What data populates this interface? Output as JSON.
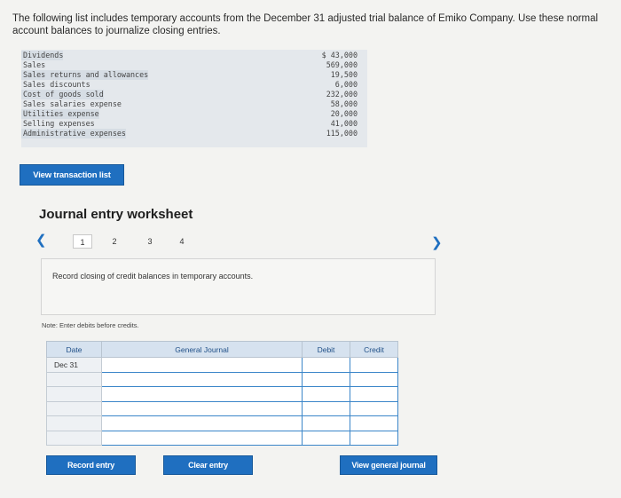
{
  "instructions": "The following list includes temporary accounts from the December 31 adjusted trial balance of Emiko Company. Use these normal account balances to journalize closing entries.",
  "accounts": [
    {
      "name": "Dividends",
      "amount": "$ 43,000"
    },
    {
      "name": "Sales",
      "amount": "569,000"
    },
    {
      "name": "Sales returns and allowances",
      "amount": "19,500"
    },
    {
      "name": "Sales discounts",
      "amount": "6,000"
    },
    {
      "name": "Cost of goods sold",
      "amount": "232,000"
    },
    {
      "name": "Sales salaries expense",
      "amount": "58,000"
    },
    {
      "name": "Utilities expense",
      "amount": "20,000"
    },
    {
      "name": "Selling expenses",
      "amount": "41,000"
    },
    {
      "name": "Administrative expenses",
      "amount": "115,000"
    }
  ],
  "buttons": {
    "view_transaction_list": "View transaction list",
    "record_entry": "Record entry",
    "clear_entry": "Clear entry",
    "view_general_journal": "View general journal"
  },
  "worksheet": {
    "title": "Journal entry worksheet",
    "pages": [
      "1",
      "2",
      "3",
      "4"
    ],
    "active_page": "1",
    "prev_icon": "chevron-left-icon",
    "next_icon": "chevron-right-icon",
    "prompt": "Record closing of credit balances in temporary accounts.",
    "note": "Note: Enter debits before credits."
  },
  "journal": {
    "headers": {
      "date": "Date",
      "general_journal": "General Journal",
      "debit": "Debit",
      "credit": "Credit"
    },
    "rows": [
      {
        "date": "Dec 31",
        "account": "",
        "debit": "",
        "credit": ""
      },
      {
        "date": "",
        "account": "",
        "debit": "",
        "credit": ""
      },
      {
        "date": "",
        "account": "",
        "debit": "",
        "credit": ""
      },
      {
        "date": "",
        "account": "",
        "debit": "",
        "credit": ""
      },
      {
        "date": "",
        "account": "",
        "debit": "",
        "credit": ""
      },
      {
        "date": "",
        "account": "",
        "debit": "",
        "credit": ""
      }
    ]
  },
  "colors": {
    "accent": "#1f6fc0",
    "header_bg": "#d6e2ef",
    "balances_bg": "#e4e8ec"
  }
}
